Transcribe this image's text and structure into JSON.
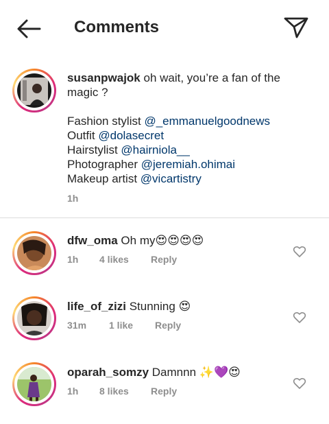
{
  "header": {
    "title": "Comments",
    "back_icon": "arrow-left-icon",
    "send_icon": "paper-plane-icon"
  },
  "post": {
    "username": "susanpwajok",
    "text": "oh wait, you’re a fan of the magic ?",
    "credits": [
      {
        "label": "Fashion stylist",
        "mention": "@_emmanuelgoodnews"
      },
      {
        "label": "Outfit",
        "mention": "@dolasecret"
      },
      {
        "label": "Hairstylist",
        "mention": "@hairniola__"
      },
      {
        "label": "Photographer",
        "mention": "@jeremiah.ohimai"
      },
      {
        "label": "Makeup artist",
        "mention": "@vicartistry"
      }
    ],
    "time": "1h"
  },
  "comments": [
    {
      "username": "dfw_oma",
      "text": "Oh my",
      "emojis": "😍😍😍😍",
      "time": "1h",
      "likes": "4 likes",
      "reply": "Reply"
    },
    {
      "username": "life_of_zizi",
      "text": "Stunning",
      "emojis": "😍",
      "time": "31m",
      "likes": "1 like",
      "reply": "Reply"
    },
    {
      "username": "oparah_somzy",
      "text": "Damnnn",
      "emojis": "✨💜😍",
      "time": "1h",
      "likes": "8 likes",
      "reply": "Reply"
    }
  ],
  "colors": {
    "mention": "#00376b",
    "meta": "#8e8e8e",
    "text": "#262626"
  }
}
